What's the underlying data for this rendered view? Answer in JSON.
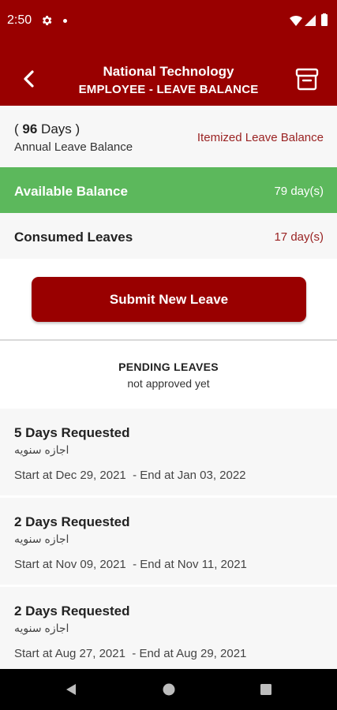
{
  "status_bar": {
    "time": "2:50",
    "icons": [
      "settings-icon",
      "notification-dot-icon",
      "wifi-icon",
      "signal-icon",
      "battery-icon"
    ]
  },
  "app_bar": {
    "title": "National Technology",
    "subtitle": "EMPLOYEE - LEAVE BALANCE",
    "back_icon": "back-chevron-icon",
    "archive_icon": "archive-box-icon"
  },
  "summary": {
    "open_paren": "( ",
    "total_days": "96",
    "days_suffix": " Days )",
    "label": "Annual Leave Balance",
    "itemized_link": "Itemized Leave Balance"
  },
  "available": {
    "label": "Available Balance",
    "value": "79 day(s)"
  },
  "consumed": {
    "label": "Consumed Leaves",
    "value": "17 day(s)"
  },
  "submit_button": "Submit New Leave",
  "pending": {
    "title": "PENDING LEAVES",
    "subtitle": "not approved yet"
  },
  "leaves": [
    {
      "requested": "5 Days Requested",
      "type": "اجازه سنويه",
      "dates": "Start at Dec 29, 2021  - End at Jan 03, 2022"
    },
    {
      "requested": "2 Days Requested",
      "type": "اجازه سنويه",
      "dates": "Start at Nov 09, 2021  - End at Nov 11, 2021"
    },
    {
      "requested": "2 Days Requested",
      "type": "اجازه سنويه",
      "dates": "Start at Aug 27, 2021  - End at Aug 29, 2021"
    }
  ],
  "colors": {
    "primary": "#990000",
    "available_green": "#5cb85c",
    "accent_text": "#9a2323",
    "row_background": "#f7f7f7"
  },
  "nav_bar": [
    "back-triangle-icon",
    "home-circle-icon",
    "recents-square-icon"
  ]
}
